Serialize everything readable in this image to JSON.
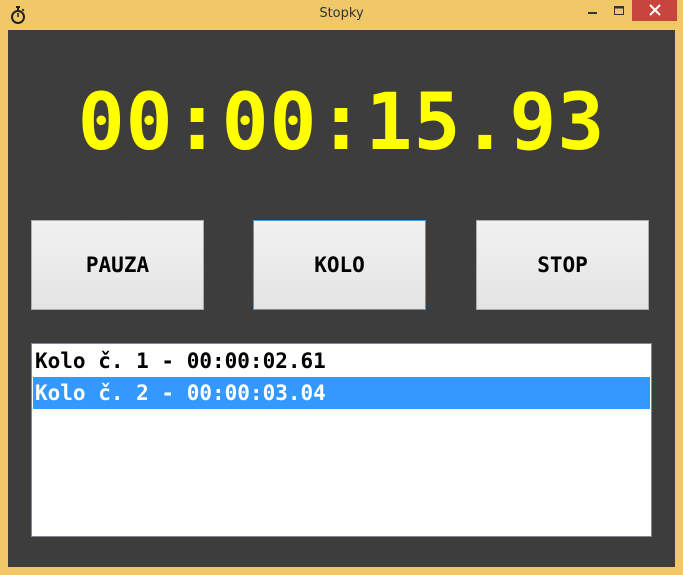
{
  "window": {
    "title": "Stopky",
    "icon": "stopwatch-icon",
    "controls": [
      "minimize-icon",
      "maximize-icon",
      "close-icon"
    ]
  },
  "timer": {
    "display": "00:00:15.93",
    "color": "#ffff00"
  },
  "buttons": {
    "pause_label": "PAUZA",
    "lap_label": "KOLO",
    "stop_label": "STOP"
  },
  "laps": {
    "items": [
      {
        "label": "Kolo č. 1 - 00:00:02.61",
        "selected": false
      },
      {
        "label": "Kolo č. 2 - 00:00:03.04",
        "selected": true
      }
    ],
    "selection_color": "#3399ff"
  },
  "colors": {
    "frame": "#f0c86a",
    "client_background": "#3d3d3d",
    "close_button": "#c7453d"
  }
}
